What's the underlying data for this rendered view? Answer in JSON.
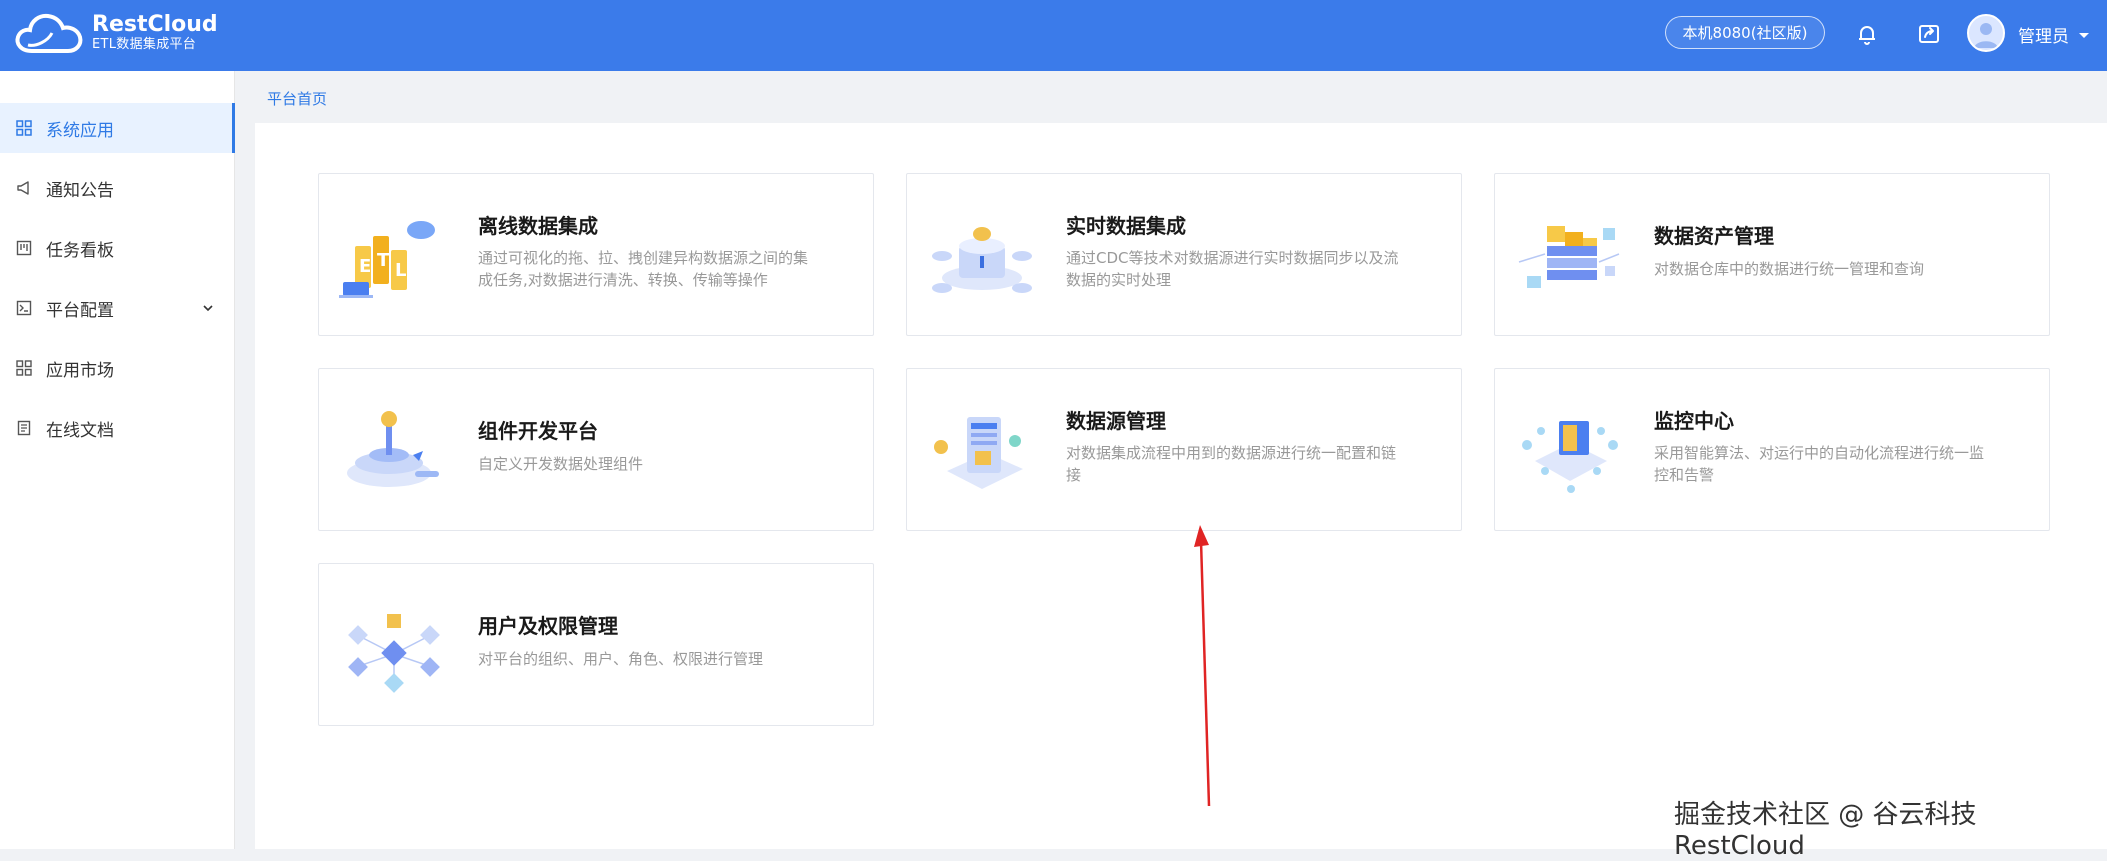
{
  "header": {
    "logo_title": "RestCloud",
    "logo_subtitle": "ETL数据集成平台",
    "server": "本机8080(社区版)",
    "user": "管理员",
    "accent": "#3b7bea"
  },
  "sidebar": {
    "items": [
      {
        "label": "系统应用",
        "icon": "grid-icon"
      },
      {
        "label": "通知公告",
        "icon": "megaphone-icon"
      },
      {
        "label": "任务看板",
        "icon": "kanban-icon"
      },
      {
        "label": "平台配置",
        "icon": "terminal-icon"
      },
      {
        "label": "应用市场",
        "icon": "apps-icon"
      },
      {
        "label": "在线文档",
        "icon": "document-icon"
      }
    ]
  },
  "breadcrumb": "平台首页",
  "cards": [
    {
      "title": "离线数据集成",
      "desc": "通过可视化的拖、拉、拽创建异构数据源之间的集成任务,对数据进行清洗、转换、传输等操作"
    },
    {
      "title": "实时数据集成",
      "desc": "通过CDC等技术对数据源进行实时数据同步以及流数据的实时处理"
    },
    {
      "title": "数据资产管理",
      "desc": "对数据仓库中的数据进行统一管理和查询"
    },
    {
      "title": "组件开发平台",
      "desc": "自定义开发数据处理组件"
    },
    {
      "title": "数据源管理",
      "desc": "对数据集成流程中用到的数据源进行统一配置和链接"
    },
    {
      "title": "监控中心",
      "desc": "采用智能算法、对运行中的自动化流程进行统一监控和告警"
    },
    {
      "title": "用户及权限管理",
      "desc": "对平台的组织、用户、角色、权限进行管理"
    }
  ],
  "watermark": "掘金技术社区 @ 谷云科技RestCloud"
}
